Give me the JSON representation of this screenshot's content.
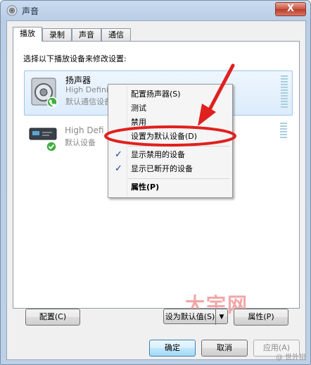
{
  "window": {
    "title": "声音",
    "close_label": "X"
  },
  "tabs": [
    {
      "label": "播放",
      "active": true
    },
    {
      "label": "录制",
      "active": false
    },
    {
      "label": "声音",
      "active": false
    },
    {
      "label": "通信",
      "active": false
    }
  ],
  "panel": {
    "instruction": "选择以下播放设备来修改设置:"
  },
  "devices": [
    {
      "name": "扬声器",
      "line1": "High Definit",
      "line2": "默认通信设备",
      "icon": "speaker-icon",
      "badge": "phone-icon",
      "selected": true
    },
    {
      "name": "",
      "line1": "High Defi",
      "line2": "默认设备",
      "icon": "monitor-device-icon",
      "badge": "check-icon",
      "selected": false
    }
  ],
  "context_menu": {
    "items": [
      {
        "label": "配置扬声器(S)",
        "checked": false,
        "bold": false
      },
      {
        "label": "测试",
        "checked": false,
        "bold": false
      },
      {
        "label": "禁用",
        "checked": false,
        "bold": false
      },
      {
        "label": "设置为默认设备(D)",
        "checked": false,
        "bold": false
      },
      {
        "label": "显示禁用的设备",
        "checked": true,
        "bold": false
      },
      {
        "label": "显示已断开的设备",
        "checked": true,
        "bold": false
      },
      {
        "label": "属性(P)",
        "checked": false,
        "bold": true
      }
    ]
  },
  "buttons": {
    "configure": "配置(C)",
    "set_default": "设为默认值(S)",
    "properties": "属性(P)",
    "ok": "确定",
    "cancel": "取消",
    "apply": "应用(A)"
  },
  "watermark": "大宇网",
  "corner_watermark": "@ 世外桃"
}
